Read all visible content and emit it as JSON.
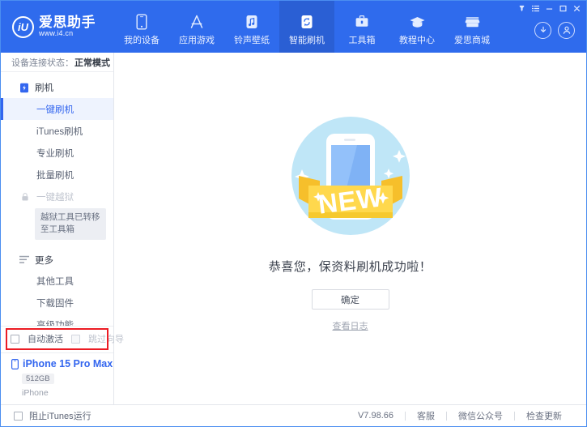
{
  "window": {
    "controls": [
      {
        "name": "pin-icon",
        "label": "置顶"
      },
      {
        "name": "menu-icon",
        "label": "菜单"
      },
      {
        "name": "minimize-icon",
        "label": "最小化"
      },
      {
        "name": "maximize-icon",
        "label": "最大化"
      },
      {
        "name": "close-icon",
        "label": "关闭"
      }
    ]
  },
  "header": {
    "logo_title": "爱思助手",
    "logo_sub": "www.i4.cn",
    "accent": "#2f6bed",
    "active_bg": "#2a5fd4",
    "nav": [
      {
        "label": "我的设备",
        "icon": "phone-icon",
        "active": false
      },
      {
        "label": "应用游戏",
        "icon": "appstore-icon",
        "active": false
      },
      {
        "label": "铃声壁纸",
        "icon": "music-icon",
        "active": false
      },
      {
        "label": "智能刷机",
        "icon": "flash-refresh-icon",
        "active": true
      },
      {
        "label": "工具箱",
        "icon": "toolbox-icon",
        "active": false
      },
      {
        "label": "教程中心",
        "icon": "graduation-cap-icon",
        "active": false
      },
      {
        "label": "爱思商城",
        "icon": "store-icon",
        "active": false
      }
    ],
    "download_icon": "download-icon",
    "account_icon": "account-icon"
  },
  "sidebar": {
    "connection_label": "设备连接状态：",
    "connection_value": "正常模式",
    "groups": [
      {
        "title": "刷机",
        "icon": "phone-flash-icon",
        "items": [
          {
            "label": "一键刷机",
            "active": true,
            "disabled": false
          },
          {
            "label": "iTunes刷机",
            "active": false,
            "disabled": false
          },
          {
            "label": "专业刷机",
            "active": false,
            "disabled": false
          },
          {
            "label": "批量刷机",
            "active": false,
            "disabled": false
          },
          {
            "label": "一键越狱",
            "active": false,
            "disabled": true,
            "icon": "lock-icon"
          }
        ],
        "tooltip": "越狱工具已转移至工具箱"
      },
      {
        "title": "更多",
        "icon": "list-icon",
        "items": [
          {
            "label": "其他工具",
            "active": false,
            "disabled": false
          },
          {
            "label": "下载固件",
            "active": false,
            "disabled": false
          },
          {
            "label": "高级功能",
            "active": false,
            "disabled": false
          }
        ]
      }
    ],
    "options": [
      {
        "label": "自动激活",
        "checked": false,
        "disabled": false
      },
      {
        "label": "跳过向导",
        "checked": false,
        "disabled": true
      }
    ],
    "highlight_color": "#ec1c24",
    "device": {
      "name": "iPhone 15 Pro Max",
      "capacity": "512GB",
      "type": "iPhone",
      "icon": "device-phone-icon",
      "name_color": "#3366ef"
    }
  },
  "main": {
    "illustration": "new-badge-phone-illustration",
    "success_message": "恭喜您，保资料刷机成功啦！",
    "confirm_label": "确定",
    "log_link_label": "查看日志"
  },
  "footer": {
    "block_itunes_label": "阻止iTunes运行",
    "block_itunes_checked": false,
    "version": "V7.98.66",
    "links": [
      "客服",
      "微信公众号",
      "检查更新"
    ]
  }
}
